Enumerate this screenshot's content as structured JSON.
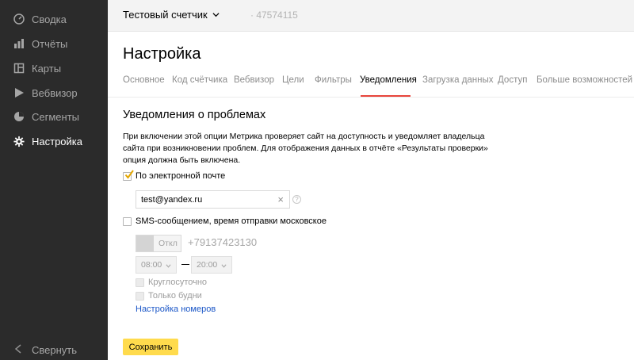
{
  "sidebar": {
    "items": [
      {
        "label": "Сводка",
        "icon": "dashboard-icon"
      },
      {
        "label": "Отчёты",
        "icon": "bar-chart-icon"
      },
      {
        "label": "Карты",
        "icon": "map-icon"
      },
      {
        "label": "Вебвизор",
        "icon": "play-icon"
      },
      {
        "label": "Сегменты",
        "icon": "segments-icon"
      },
      {
        "label": "Настройка",
        "icon": "gear-icon"
      }
    ],
    "collapse_label": "Свернуть"
  },
  "header": {
    "counter_name": "Тестовый счетчик",
    "counter_id": "· 47574115"
  },
  "page": {
    "title": "Настройка",
    "tabs": [
      "Основное",
      "Код счётчика",
      "Вебвизор",
      "Цели",
      "Фильтры",
      "Уведомления",
      "Загрузка данных",
      "Доступ",
      "Больше возможностей"
    ],
    "active_tab": "Уведомления"
  },
  "notifications": {
    "section_title": "Уведомления о проблемах",
    "description": "При включении этой опции Метрика проверяет сайт на доступность и уведомляет владельца сайта при возникновении проблем. Для отображения данных в отчёте «Результаты проверки» опция должна быть включена.",
    "email_checkbox_label": "По электронной почте",
    "email_checked": true,
    "email_value": "test@yandex.ru",
    "help_symbol": "?",
    "sms_checkbox_label": "SMS-сообщением, время отправки московское",
    "sms_checked": false,
    "toggle_label": "Откл",
    "phone": "+79137423130",
    "time_from": "08:00",
    "time_to": "20:00",
    "around_clock_label": "Круглосуточно",
    "weekdays_label": "Только будни",
    "phones_link": "Настройка номеров",
    "save_label": "Сохранить"
  },
  "colors": {
    "sidebar_bg": "#2b2b2b",
    "accent_underline": "#e8453c",
    "save_button": "#ffdb4d",
    "link": "#1a56c7",
    "checkbox_tick": "#e3a600"
  }
}
